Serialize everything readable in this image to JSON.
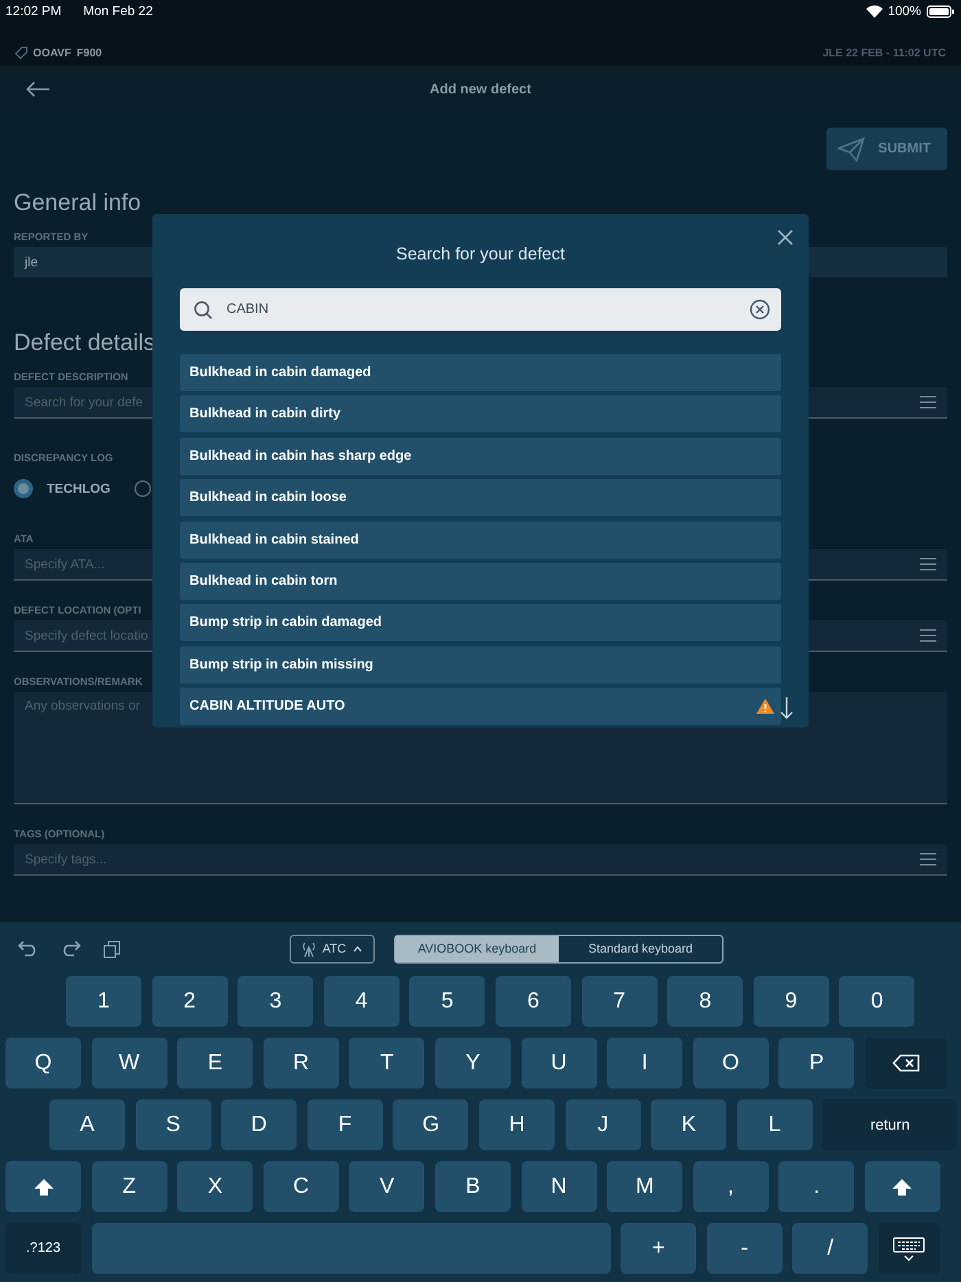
{
  "status_bar": {
    "time": "12:02 PM",
    "date": "Mon Feb 22",
    "battery": "100%"
  },
  "aircraft_bar": {
    "registration": "OOAVF",
    "type": "F900",
    "info": "JLE 22 FEB - 11:02 UTC"
  },
  "header": {
    "title": "Add new defect",
    "submit": "SUBMIT"
  },
  "form": [
    {
      "kind": "heading",
      "text": "General info"
    },
    {
      "kind": "field",
      "label": "REPORTED BY",
      "value": "jle"
    },
    {
      "kind": "heading",
      "text": "Defect details"
    },
    {
      "kind": "field",
      "label": "DEFECT DESCRIPTION",
      "placeholder": "Search for your defe",
      "menu": true
    },
    {
      "kind": "radios",
      "label": "DISCREPANCY LOG",
      "options": [
        {
          "label": "TECHLOG",
          "selected": true
        },
        {
          "selected": false
        }
      ]
    },
    {
      "kind": "field",
      "label": "ATA",
      "placeholder": "Specify ATA...",
      "menu": true
    },
    {
      "kind": "field",
      "label": "DEFECT LOCATION (OPTI",
      "placeholder": "Specify defect locatio",
      "menu": true
    },
    {
      "kind": "textarea",
      "label": "OBSERVATIONS/REMARK",
      "placeholder": "Any observations or"
    },
    {
      "kind": "field",
      "label": "TAGS (OPTIONAL)",
      "placeholder": "Specify tags...",
      "menu": true
    }
  ],
  "modal": {
    "title": "Search for your defect",
    "search": "CABIN",
    "results": [
      {
        "label": "Bulkhead in cabin damaged",
        "warning": false
      },
      {
        "label": "Bulkhead in cabin dirty",
        "warning": false
      },
      {
        "label": "Bulkhead in cabin has sharp edge",
        "warning": false
      },
      {
        "label": "Bulkhead in cabin loose",
        "warning": false
      },
      {
        "label": "Bulkhead in cabin stained",
        "warning": false
      },
      {
        "label": "Bulkhead in cabin torn",
        "warning": false
      },
      {
        "label": "Bump strip in cabin damaged",
        "warning": false
      },
      {
        "label": "Bump strip in cabin missing",
        "warning": false
      },
      {
        "label": "CABIN ALTITUDE AUTO",
        "warning": true
      }
    ]
  },
  "keyboard": {
    "atc": "ATC",
    "tabs": [
      {
        "label": "AVIOBOOK keyboard",
        "selected": true
      },
      {
        "label": "Standard keyboard",
        "selected": false
      }
    ],
    "rows": [
      [
        {
          "kind": "key",
          "label": "1"
        },
        {
          "kind": "key",
          "label": "2"
        },
        {
          "kind": "key",
          "label": "3"
        },
        {
          "kind": "key",
          "label": "4"
        },
        {
          "kind": "key",
          "label": "5"
        },
        {
          "kind": "key",
          "label": "6"
        },
        {
          "kind": "key",
          "label": "7"
        },
        {
          "kind": "key",
          "label": "8"
        },
        {
          "kind": "key",
          "label": "9"
        },
        {
          "kind": "key",
          "label": "0"
        }
      ],
      [
        {
          "kind": "key",
          "label": "Q"
        },
        {
          "kind": "key",
          "label": "W"
        },
        {
          "kind": "key",
          "label": "E"
        },
        {
          "kind": "key",
          "label": "R"
        },
        {
          "kind": "key",
          "label": "T"
        },
        {
          "kind": "key",
          "label": "Y"
        },
        {
          "kind": "key",
          "label": "U"
        },
        {
          "kind": "key",
          "label": "I"
        },
        {
          "kind": "key",
          "label": "O"
        },
        {
          "kind": "key",
          "label": "P"
        },
        {
          "kind": "backspace"
        }
      ],
      [
        {
          "kind": "key",
          "label": "A"
        },
        {
          "kind": "key",
          "label": "S"
        },
        {
          "kind": "key",
          "label": "D"
        },
        {
          "kind": "key",
          "label": "F"
        },
        {
          "kind": "key",
          "label": "G"
        },
        {
          "kind": "key",
          "label": "H"
        },
        {
          "kind": "key",
          "label": "J"
        },
        {
          "kind": "key",
          "label": "K"
        },
        {
          "kind": "key",
          "label": "L"
        },
        {
          "kind": "wide",
          "label": "return"
        }
      ],
      [
        {
          "kind": "shift"
        },
        {
          "kind": "key",
          "label": "Z"
        },
        {
          "kind": "key",
          "label": "X"
        },
        {
          "kind": "key",
          "label": "C"
        },
        {
          "kind": "key",
          "label": "V"
        },
        {
          "kind": "key",
          "label": "B"
        },
        {
          "kind": "key",
          "label": "N"
        },
        {
          "kind": "key",
          "label": "M"
        },
        {
          "kind": "key",
          "label": ","
        },
        {
          "kind": "key",
          "label": "."
        },
        {
          "kind": "shift"
        }
      ],
      [
        {
          "kind": "mode",
          "label": ".?123"
        },
        {
          "kind": "space"
        },
        {
          "kind": "key",
          "label": "+"
        },
        {
          "kind": "key",
          "label": "-"
        },
        {
          "kind": "key",
          "label": "/"
        },
        {
          "kind": "hide"
        }
      ]
    ]
  }
}
